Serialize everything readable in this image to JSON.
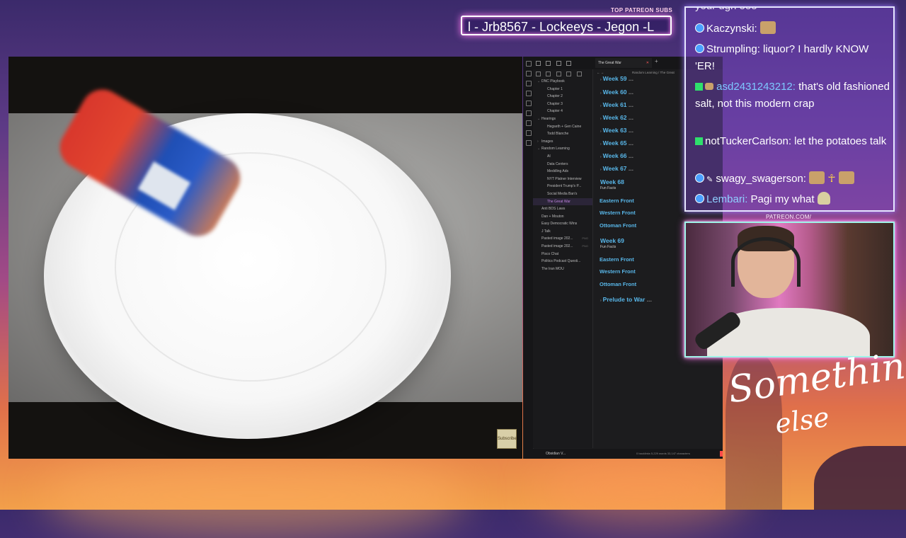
{
  "patreon": {
    "label": "TOP PATREON SUBS",
    "ticker": "l - Jrb8567 - Lockeeys - Jegon -L"
  },
  "video": {
    "subscribe_label": "Subscribe"
  },
  "obsidian": {
    "tab_title": "The Great War",
    "breadcrumb": "Random Learning  /  The Great",
    "footer_label": "Obsidian V...",
    "status": "0 backlinks   5,229 words  33,147 characters",
    "tree": [
      {
        "label": "DNC Playbook",
        "indent": 1,
        "arrow": "⌄"
      },
      {
        "label": "Chapter 1",
        "indent": 2
      },
      {
        "label": "Chapter 2",
        "indent": 2
      },
      {
        "label": "Chapter 3",
        "indent": 2
      },
      {
        "label": "Chapter 4",
        "indent": 2
      },
      {
        "label": "Hearings",
        "indent": 1,
        "arrow": "⌄"
      },
      {
        "label": "Hegseth + Gen Caine",
        "indent": 2
      },
      {
        "label": "Todd Blanche",
        "indent": 2
      },
      {
        "label": "Images",
        "indent": 1,
        "arrow": "›"
      },
      {
        "label": "Random Learning",
        "indent": 1,
        "arrow": "⌄"
      },
      {
        "label": "AI",
        "indent": 2
      },
      {
        "label": "Data Centers",
        "indent": 2
      },
      {
        "label": "Meddling Ads",
        "indent": 2
      },
      {
        "label": "NYT Platner Interview",
        "indent": 2
      },
      {
        "label": "President Trump's P...",
        "indent": 2
      },
      {
        "label": "Social Media Ban's",
        "indent": 2
      },
      {
        "label": "The Great War",
        "indent": 2,
        "active": true
      },
      {
        "label": "Anti BDS Laws",
        "indent": 1
      },
      {
        "label": "Dan + Mouton",
        "indent": 1
      },
      {
        "label": "Easy Democratic Wins",
        "indent": 1
      },
      {
        "label": "J Talk",
        "indent": 1
      },
      {
        "label": "Pasted image 202...",
        "indent": 1,
        "meta": "PNG"
      },
      {
        "label": "Pasted image 202...",
        "indent": 1,
        "meta": "PNG"
      },
      {
        "label": "Pisco Chat",
        "indent": 1
      },
      {
        "label": "Politics Podcast Questi...",
        "indent": 1
      },
      {
        "label": "The Iran MOU",
        "indent": 1
      }
    ],
    "headings": {
      "w59": "Week 59",
      "w60": "Week 60",
      "w61": "Week 61",
      "w62": "Week 62",
      "w63": "Week 63",
      "w65": "Week 65",
      "w66": "Week 66",
      "w67": "Week 67",
      "w68": "Week 68",
      "w68_sub": "Fun Facts",
      "w68_a": "Eastern Front",
      "w68_b": "Western Front",
      "w68_c": "Ottoman Front",
      "w69": "Week 69",
      "w69_sub": "Fun Facts",
      "w69_a": "Eastern Front",
      "w69_b": "Western Front",
      "w69_c": "Ottoman Front",
      "prelude": "Prelude to War",
      "dots": "..."
    }
  },
  "chat": {
    "lines": {
      "l0": "your ugh ooo",
      "l1_user": "Kaczynski:",
      "l2_user": "Strumpling:",
      "l2_msg": "liquor? I hardly KNOW 'ER!",
      "l3_user": "asd2431243212:",
      "l3_msg": "that's old fashioned salt, not this modern crap",
      "l4_user": "notTuckerCarlson:",
      "l4_msg": "let the potatoes talk",
      "l5_user": "swagy_swagerson:",
      "l6_user": "Lembari:",
      "l6_msg": "Pagi my what"
    },
    "colors": {
      "asd": "#7ec8ff",
      "lembari": "#8fd0ff",
      "default": "#ffffff"
    }
  },
  "webcam": {
    "patreon_url": "PATREON.COM/",
    "brand_script_line1": "Something",
    "brand_script_line2": "else"
  }
}
